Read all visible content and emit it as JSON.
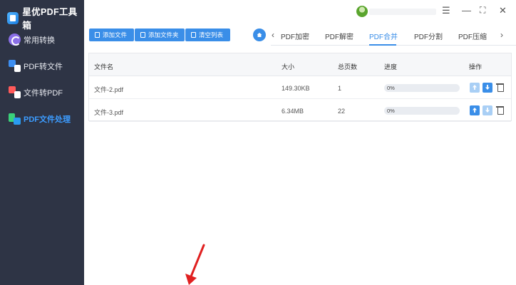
{
  "app": {
    "title": "星优PDF工具箱"
  },
  "sidebar": {
    "items": [
      {
        "label": "常用转换",
        "icon": "common-convert-icon"
      },
      {
        "label": "PDF转文件",
        "icon": "pdf-to-file-icon"
      },
      {
        "label": "文件转PDF",
        "icon": "file-to-pdf-icon"
      },
      {
        "label": "PDF文件处理",
        "icon": "pdf-process-icon",
        "active": true
      }
    ]
  },
  "toolbar": {
    "add_file": "添加文件",
    "add_folder": "添加文件夹",
    "clear_list": "清空列表"
  },
  "tabs": [
    {
      "label": "PDF加密"
    },
    {
      "label": "PDF解密"
    },
    {
      "label": "PDF合并",
      "active": true
    },
    {
      "label": "PDF分割"
    },
    {
      "label": "PDF压缩"
    }
  ],
  "table": {
    "headers": {
      "name": "文件名",
      "size": "大小",
      "pages": "总页数",
      "progress": "进度",
      "actions": "操作"
    },
    "rows": [
      {
        "name": "文件-2.pdf",
        "size": "149.30KB",
        "pages": "1",
        "progress": "0%"
      },
      {
        "name": "文件-3.pdf",
        "size": "6.34MB",
        "pages": "22",
        "progress": "0%"
      }
    ]
  },
  "colors": {
    "accent": "#3a8ee8",
    "sidebar_bg": "#2e3445",
    "annotation_arrow": "#e02020"
  }
}
